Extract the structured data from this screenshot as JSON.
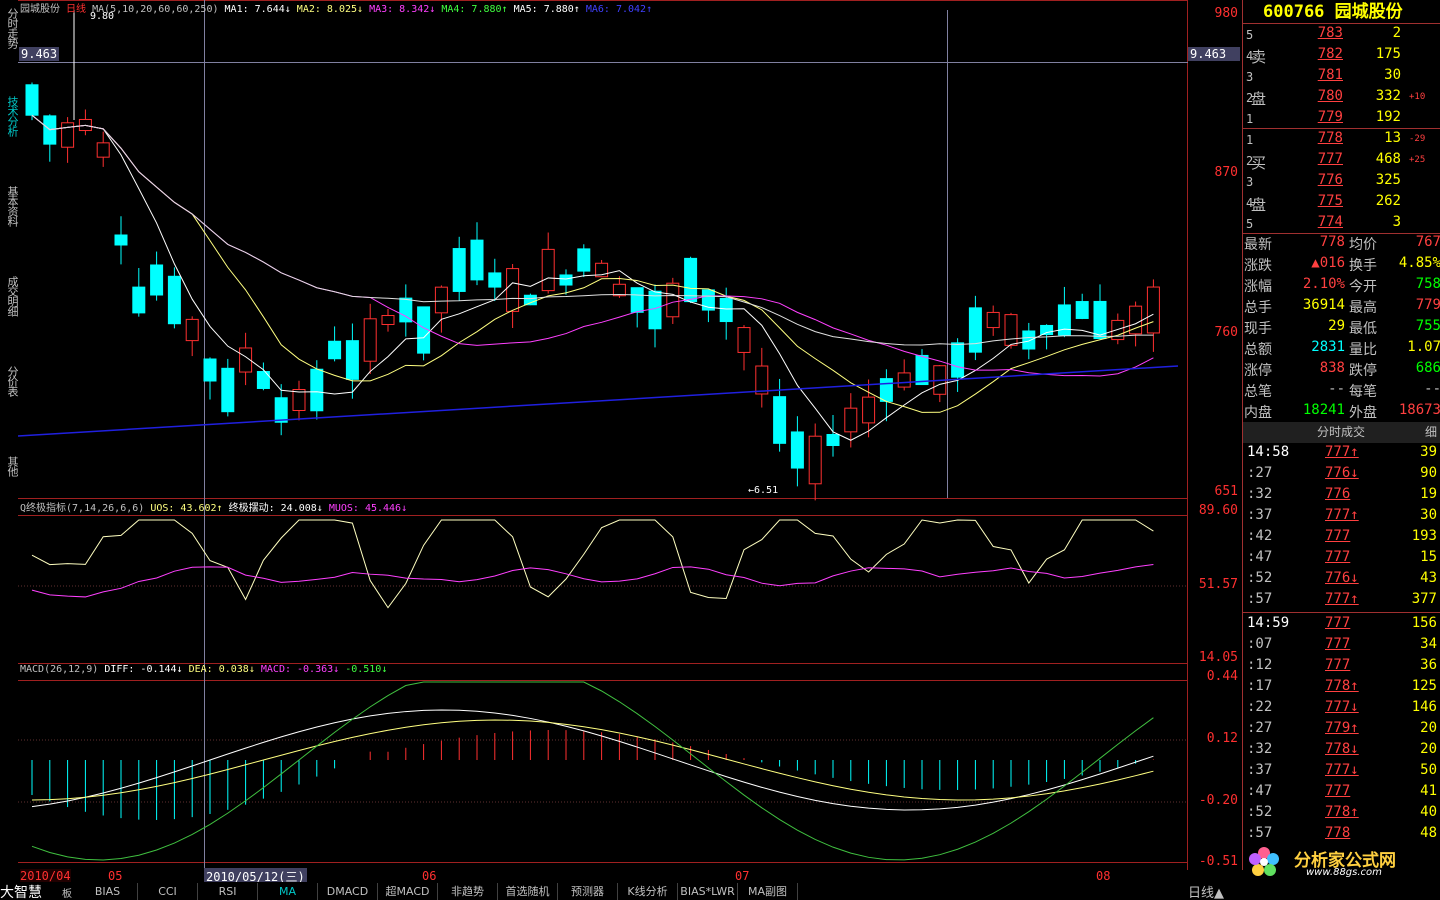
{
  "left_tabs": [
    "分时走势",
    "技术分析",
    "基本资料",
    "成交明细",
    "分价表",
    "其他"
  ],
  "header": {
    "stock_name": "园城股份",
    "period": "日线",
    "ma_params": "MA(5,10,20,60,60,250)",
    "ma1": "MA1: 7.644↓",
    "ma2": "MA2: 8.025↓",
    "ma3": "MA3: 8.342↓",
    "ma4": "MA4: 7.880↑",
    "ma5": "MA5: 7.880↑",
    "ma6": "MA6: 7.042↑",
    "high_mark": "9.80",
    "low_mark": "←6.51",
    "crosshair_value": "9.463"
  },
  "price_axis": [
    "980",
    "870",
    "760",
    "651"
  ],
  "uos_header": {
    "name": "Q终极指标(7,14,26,6,6)",
    "uos": "UOS: 43.602↑",
    "osc": "终极摆动: 24.008↓",
    "muos": "MUOS: 45.446↓"
  },
  "uos_axis": [
    "89.60",
    "51.57",
    "14.05"
  ],
  "macd_header": {
    "name": "MACD(26,12,9)",
    "diff": "DIFF: -0.144↓",
    "dea": "DEA: 0.038↓",
    "macd": "MACD: -0.363↓",
    "extra": "-0.510↓"
  },
  "macd_axis": [
    "0.44",
    "0.12",
    "-0.20",
    "-0.51"
  ],
  "date_axis": {
    "start": "2010/04",
    "m05": "05",
    "cursor_date": "2010/05/12(三)",
    "m06": "06",
    "m07": "07",
    "m08": "08"
  },
  "panel": {
    "code": "600766",
    "name": "园城股份",
    "sell_label": [
      "卖",
      "盘"
    ],
    "buy_label": [
      "买",
      "盘"
    ],
    "sell": [
      {
        "level": "5",
        "price": "783",
        "vol": "2",
        "extra": ""
      },
      {
        "level": "4",
        "price": "782",
        "vol": "175",
        "extra": ""
      },
      {
        "level": "3",
        "price": "781",
        "vol": "30",
        "extra": ""
      },
      {
        "level": "2",
        "price": "780",
        "vol": "332",
        "extra": "+10"
      },
      {
        "level": "1",
        "price": "779",
        "vol": "192",
        "extra": ""
      }
    ],
    "buy": [
      {
        "level": "1",
        "price": "778",
        "vol": "13",
        "extra": "-29"
      },
      {
        "level": "2",
        "price": "777",
        "vol": "468",
        "extra": "+25"
      },
      {
        "level": "3",
        "price": "776",
        "vol": "325",
        "extra": ""
      },
      {
        "level": "4",
        "price": "775",
        "vol": "262",
        "extra": ""
      },
      {
        "level": "5",
        "price": "774",
        "vol": "3",
        "extra": ""
      }
    ],
    "quote": [
      {
        "k1": "最新",
        "v1": "778",
        "c1": "#ff4040",
        "k2": "均价",
        "v2": "767",
        "c2": "#ff4040"
      },
      {
        "k1": "涨跌",
        "v1": "▲016",
        "c1": "#ff4040",
        "k2": "换手",
        "v2": "4.85%",
        "c2": "#ffff00"
      },
      {
        "k1": "涨幅",
        "v1": "2.10%",
        "c1": "#ff4040",
        "k2": "今开",
        "v2": "758",
        "c2": "#00ff00"
      },
      {
        "k1": "总手",
        "v1": "36914",
        "c1": "#ffff00",
        "k2": "最高",
        "v2": "779",
        "c2": "#ff4040"
      },
      {
        "k1": "现手",
        "v1": "29",
        "c1": "#ffff00",
        "k2": "最低",
        "v2": "755",
        "c2": "#00ff00"
      },
      {
        "k1": "总额",
        "v1": "2831",
        "c1": "#00ffff",
        "k2": "量比",
        "v2": "1.07",
        "c2": "#ffff00"
      },
      {
        "k1": "涨停",
        "v1": "838",
        "c1": "#ff4040",
        "k2": "跌停",
        "v2": "686",
        "c2": "#00ff00"
      },
      {
        "k1": "总笔",
        "v1": "--",
        "c1": "#c0c0c0",
        "k2": "每笔",
        "v2": "--",
        "c2": "#c0c0c0"
      },
      {
        "k1": "内盘",
        "v1": "18241",
        "c1": "#00ff00",
        "k2": "外盘",
        "v2": "18673",
        "c2": "#ff4040"
      }
    ],
    "tick_header": "分时成交",
    "tick_detail": "细",
    "ticks": [
      {
        "time": "14:58",
        "price": "777↑",
        "vol": "39"
      },
      {
        "time": ":27",
        "price": "776↓",
        "vol": "90"
      },
      {
        "time": ":32",
        "price": "776",
        "vol": "19"
      },
      {
        "time": ":37",
        "price": "777↑",
        "vol": "30"
      },
      {
        "time": ":42",
        "price": "777",
        "vol": "193"
      },
      {
        "time": ":47",
        "price": "777",
        "vol": "15"
      },
      {
        "time": ":52",
        "price": "776↓",
        "vol": "43"
      },
      {
        "time": ":57",
        "price": "777↑",
        "vol": "377"
      },
      {
        "time": "14:59",
        "price": "777",
        "vol": "156"
      },
      {
        "time": ":07",
        "price": "777",
        "vol": "34"
      },
      {
        "time": ":12",
        "price": "777",
        "vol": "36"
      },
      {
        "time": ":17",
        "price": "778↑",
        "vol": "125"
      },
      {
        "time": ":22",
        "price": "777↓",
        "vol": "146"
      },
      {
        "time": ":27",
        "price": "779↑",
        "vol": "20"
      },
      {
        "time": ":32",
        "price": "778↓",
        "vol": "20"
      },
      {
        "time": ":37",
        "price": "777↓",
        "vol": "50"
      },
      {
        "time": ":47",
        "price": "777",
        "vol": "41"
      },
      {
        "time": ":52",
        "price": "778↑",
        "vol": "40"
      },
      {
        "time": ":57",
        "price": "778",
        "vol": "48"
      }
    ]
  },
  "bottom": {
    "app": "大智慧",
    "board": "板",
    "tabs": [
      "BIAS",
      "CCI",
      "RSI",
      "MA",
      "DMACD",
      "超MACD",
      "非趋势",
      "首选随机",
      "预测器",
      "K线分析",
      "BIAS*LWR",
      "MA副图"
    ],
    "active_tab": "MA",
    "period_label": "日线▲"
  },
  "logo": {
    "title": "分析家公式网",
    "url": "www.88gs.com"
  },
  "colors": {
    "up": "#ff3030",
    "down": "#00ffff",
    "ma_white": "#ffffff",
    "ma_yellow": "#ffff80",
    "ma_magenta": "#ff00ff",
    "ma_blue": "#4040ff"
  }
}
